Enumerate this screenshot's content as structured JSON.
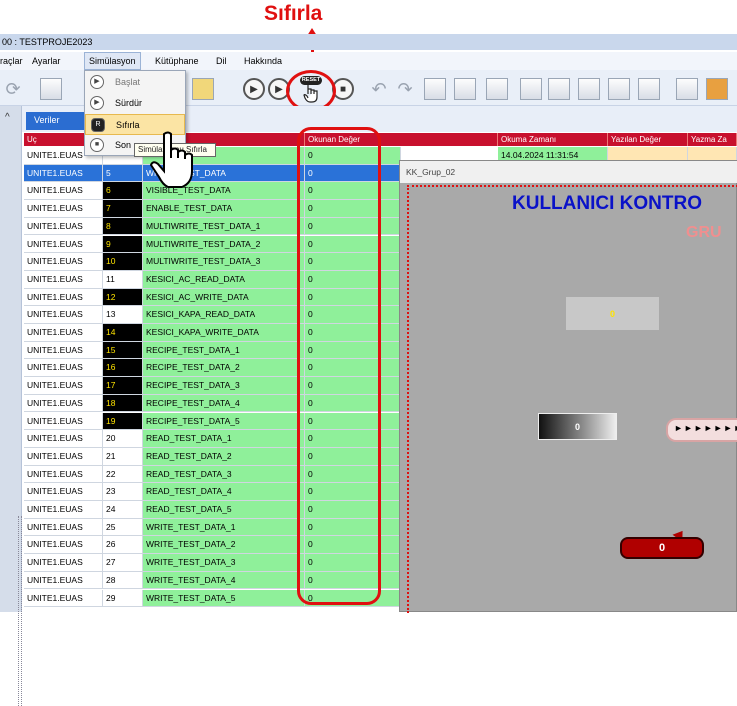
{
  "callout": {
    "title": "Sıfırla"
  },
  "window": {
    "title": "00 : TESTPROJE2023"
  },
  "menu": [
    "raçlar",
    "Ayarlar",
    "Simülasyon",
    "Kütüphane",
    "Dil",
    "Hakkında"
  ],
  "dropdown": {
    "items": [
      {
        "label": "Başlat",
        "icon": "play-icon"
      },
      {
        "label": "Sürdür",
        "icon": "resume-icon"
      },
      {
        "label": "Sıfırla",
        "icon": "reset-icon"
      },
      {
        "label": "Son",
        "icon": "stop-icon"
      }
    ],
    "tooltip": "Simülasyonu Sıfırla"
  },
  "tabs": {
    "veriler": "Veriler"
  },
  "reset_pill": "RESET",
  "grid": {
    "headers": {
      "uc": "Uç",
      "okunan": "Okunan Değer",
      "okuma_zamani": "Okuma Zamanı",
      "yazilan": "Yazılan Değer",
      "yazma": "Yazma Za"
    },
    "first_row_time": "14.04.2024 11:31:54",
    "rows": [
      {
        "uc": "UNITE1.EUAS",
        "id": "",
        "name": "",
        "value": "0",
        "id_black": false
      },
      {
        "uc": "UNITE1.EUAS",
        "id": "5",
        "name": "WRITE_TEST_DATA",
        "value": "0",
        "id_black": false,
        "selected": true
      },
      {
        "uc": "UNITE1.EUAS",
        "id": "6",
        "name": "VISIBLE_TEST_DATA",
        "value": "0",
        "id_black": true
      },
      {
        "uc": "UNITE1.EUAS",
        "id": "7",
        "name": "ENABLE_TEST_DATA",
        "value": "0",
        "id_black": true
      },
      {
        "uc": "UNITE1.EUAS",
        "id": "8",
        "name": "MULTIWRITE_TEST_DATA_1",
        "value": "0",
        "id_black": true
      },
      {
        "uc": "UNITE1.EUAS",
        "id": "9",
        "name": "MULTIWRITE_TEST_DATA_2",
        "value": "0",
        "id_black": true
      },
      {
        "uc": "UNITE1.EUAS",
        "id": "10",
        "name": "MULTIWRITE_TEST_DATA_3",
        "value": "0",
        "id_black": true
      },
      {
        "uc": "UNITE1.EUAS",
        "id": "11",
        "name": "KESICI_AC_READ_DATA",
        "value": "0",
        "id_black": false
      },
      {
        "uc": "UNITE1.EUAS",
        "id": "12",
        "name": "KESICI_AC_WRITE_DATA",
        "value": "0",
        "id_black": true
      },
      {
        "uc": "UNITE1.EUAS",
        "id": "13",
        "name": "KESICI_KAPA_READ_DATA",
        "value": "0",
        "id_black": false
      },
      {
        "uc": "UNITE1.EUAS",
        "id": "14",
        "name": "KESICI_KAPA_WRITE_DATA",
        "value": "0",
        "id_black": true
      },
      {
        "uc": "UNITE1.EUAS",
        "id": "15",
        "name": "RECIPE_TEST_DATA_1",
        "value": "0",
        "id_black": true
      },
      {
        "uc": "UNITE1.EUAS",
        "id": "16",
        "name": "RECIPE_TEST_DATA_2",
        "value": "0",
        "id_black": true
      },
      {
        "uc": "UNITE1.EUAS",
        "id": "17",
        "name": "RECIPE_TEST_DATA_3",
        "value": "0",
        "id_black": true
      },
      {
        "uc": "UNITE1.EUAS",
        "id": "18",
        "name": "RECIPE_TEST_DATA_4",
        "value": "0",
        "id_black": true
      },
      {
        "uc": "UNITE1.EUAS",
        "id": "19",
        "name": "RECIPE_TEST_DATA_5",
        "value": "0",
        "id_black": true
      },
      {
        "uc": "UNITE1.EUAS",
        "id": "20",
        "name": "READ_TEST_DATA_1",
        "value": "0",
        "id_black": false
      },
      {
        "uc": "UNITE1.EUAS",
        "id": "21",
        "name": "READ_TEST_DATA_2",
        "value": "0",
        "id_black": false
      },
      {
        "uc": "UNITE1.EUAS",
        "id": "22",
        "name": "READ_TEST_DATA_3",
        "value": "0",
        "id_black": false
      },
      {
        "uc": "UNITE1.EUAS",
        "id": "23",
        "name": "READ_TEST_DATA_4",
        "value": "0",
        "id_black": false
      },
      {
        "uc": "UNITE1.EUAS",
        "id": "24",
        "name": "READ_TEST_DATA_5",
        "value": "0",
        "id_black": false
      },
      {
        "uc": "UNITE1.EUAS",
        "id": "25",
        "name": "WRITE_TEST_DATA_1",
        "value": "0",
        "id_black": false
      },
      {
        "uc": "UNITE1.EUAS",
        "id": "26",
        "name": "WRITE_TEST_DATA_2",
        "value": "0",
        "id_black": false
      },
      {
        "uc": "UNITE1.EUAS",
        "id": "27",
        "name": "WRITE_TEST_DATA_3",
        "value": "0",
        "id_black": false
      },
      {
        "uc": "UNITE1.EUAS",
        "id": "28",
        "name": "WRITE_TEST_DATA_4",
        "value": "0",
        "id_black": false
      },
      {
        "uc": "UNITE1.EUAS",
        "id": "29",
        "name": "WRITE_TEST_DATA_5",
        "value": "0",
        "id_black": false
      }
    ]
  },
  "panel": {
    "title": "KK_Grup_02",
    "heading": "KULLANICI KONTRO",
    "subheading": "GRU",
    "box1_value": "0",
    "box2_value": "0",
    "box3_text": "►►►►►►►",
    "badge_value": "0"
  },
  "colors": {
    "accent_red": "#e01010",
    "header_red": "#c8102e",
    "cell_green": "#8ff09a",
    "selection_blue": "#2a72d8",
    "heading_blue": "#0a12c8"
  }
}
